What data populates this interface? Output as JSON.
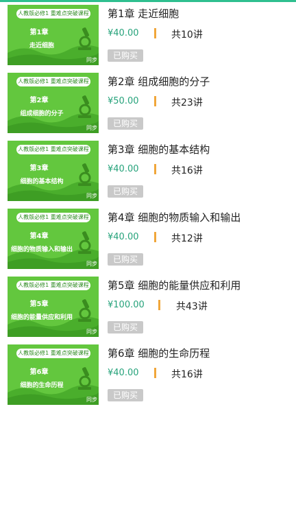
{
  "colors": {
    "accent": "#2fbf8f",
    "thumb_green": "#63c73e",
    "price_green": "#25a27a",
    "separator_orange": "#f0a63a",
    "purchased_gray": "#c9c9c9"
  },
  "courses": [
    {
      "banner": "人教版必修1 重难点突破课程",
      "chapter_label": "第1章",
      "subtitle": "走近细胞",
      "tag": "同步",
      "title": "第1章 走近细胞",
      "price": "¥40.00",
      "lessons": "共10讲",
      "status": "已购买"
    },
    {
      "banner": "人教版必修1 重难点突破课程",
      "chapter_label": "第2章",
      "subtitle": "组成细胞的分子",
      "tag": "同步",
      "title": "第2章 组成细胞的分子",
      "price": "¥50.00",
      "lessons": "共23讲",
      "status": "已购买"
    },
    {
      "banner": "人教版必修1 重难点突破课程",
      "chapter_label": "第3章",
      "subtitle": "细胞的基本结构",
      "tag": "同步",
      "title": "第3章 细胞的基本结构",
      "price": "¥40.00",
      "lessons": "共16讲",
      "status": "已购买"
    },
    {
      "banner": "人教版必修1 重难点突破课程",
      "chapter_label": "第4章",
      "subtitle": "细胞的物质输入和输出",
      "tag": "同步",
      "title": "第4章 细胞的物质输入和输出",
      "price": "¥40.00",
      "lessons": "共12讲",
      "status": "已购买"
    },
    {
      "banner": "人教版必修1 重难点突破课程",
      "chapter_label": "第5章",
      "subtitle": "细胞的能量供应和利用",
      "tag": "同步",
      "title": "第5章 细胞的能量供应和利用",
      "price": "¥100.00",
      "lessons": "共43讲",
      "status": "已购买"
    },
    {
      "banner": "人教版必修1 重难点突破课程",
      "chapter_label": "第6章",
      "subtitle": "细胞的生命历程",
      "tag": "同步",
      "title": "第6章 细胞的生命历程",
      "price": "¥40.00",
      "lessons": "共16讲",
      "status": "已购买"
    }
  ]
}
